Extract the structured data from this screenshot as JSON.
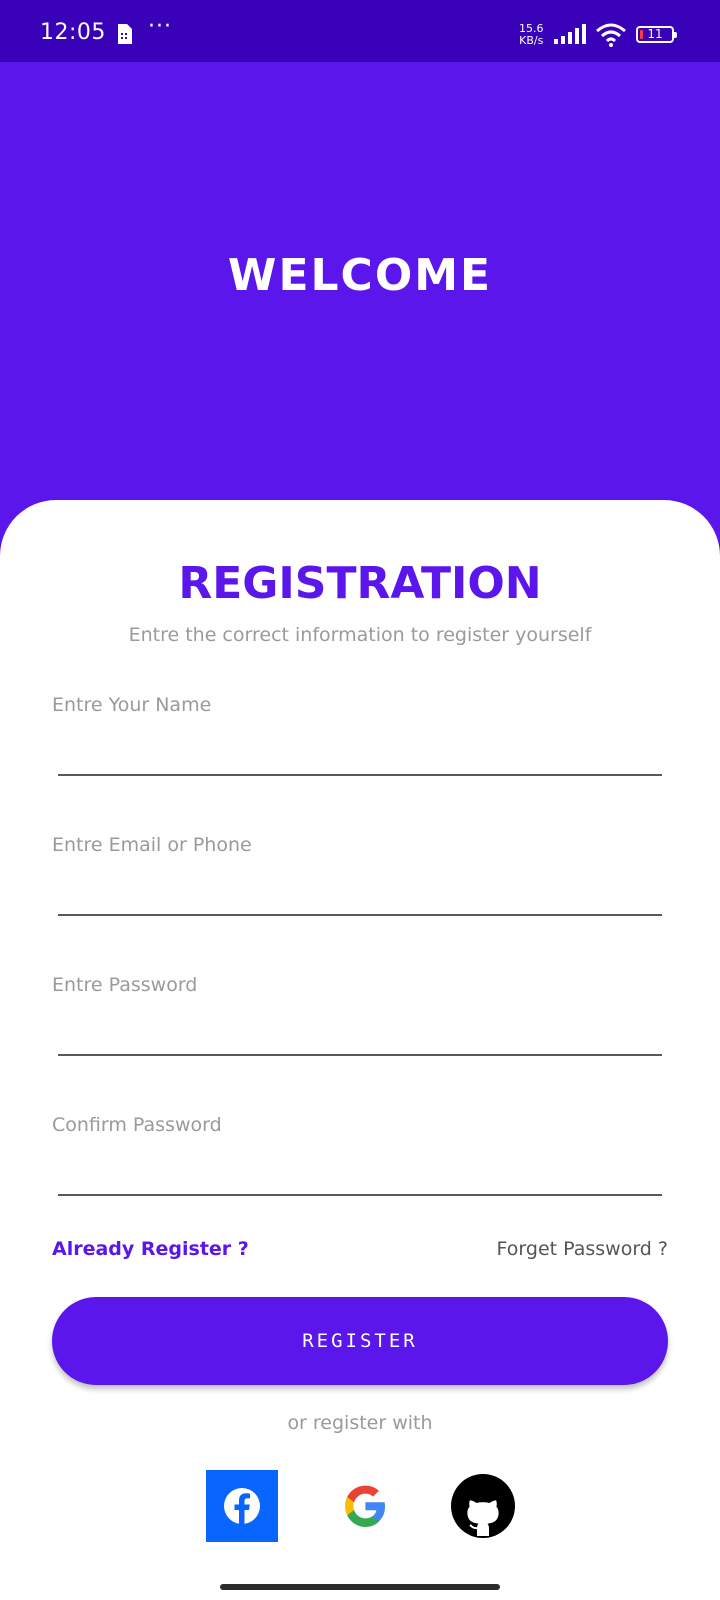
{
  "status_bar": {
    "time": "12:05",
    "dots": "···",
    "net_speed_value": "15.6",
    "net_speed_unit": "KB/s",
    "battery": "11"
  },
  "header": {
    "title": "WELCOME"
  },
  "form": {
    "title": "REGISTRATION",
    "subtitle": "Entre the correct information to register yourself",
    "fields": [
      {
        "label": "Entre Your Name",
        "value": ""
      },
      {
        "label": "Entre Email or Phone",
        "value": ""
      },
      {
        "label": "Entre Password",
        "value": ""
      },
      {
        "label": "Confirm Password",
        "value": ""
      }
    ],
    "already_register": "Already Register ?",
    "forget_password": "Forget Password ?",
    "register_button": "REGISTER",
    "or_register_with": "or register with"
  },
  "social_icons": [
    "facebook-icon",
    "google-icon",
    "github-icon"
  ],
  "colors": {
    "primary": "#5b16ec",
    "status_bar": "#3a02b8",
    "facebook": "#0866ff"
  }
}
